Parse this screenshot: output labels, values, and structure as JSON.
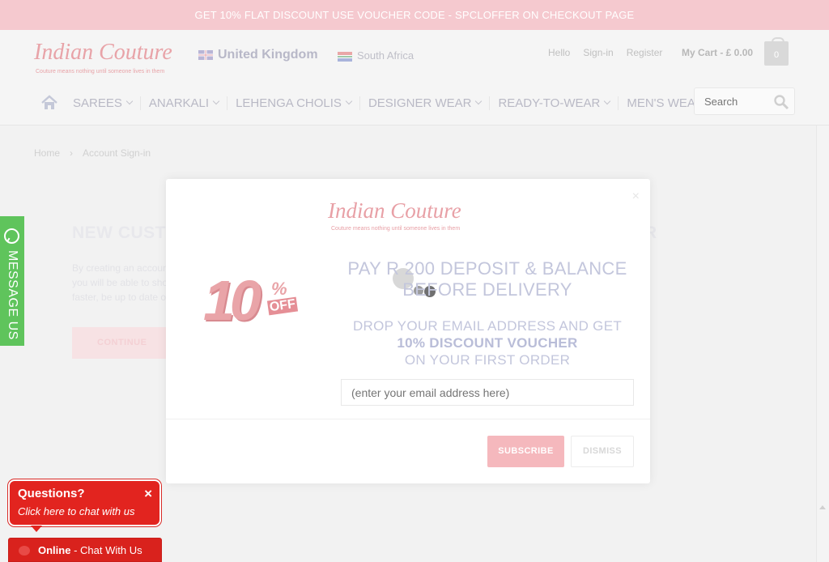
{
  "promo": {
    "text": "GET 10% FLAT DISCOUNT USE VOUCHER CODE - SPCLOFFER ON CHECKOUT PAGE"
  },
  "header": {
    "logo_text": "Indian Couture",
    "logo_tagline": "Couture means nothing until someone lives in them",
    "country_primary": "United Kingdom",
    "country_secondary": "South Africa",
    "hello": "Hello",
    "signin": "Sign-in",
    "register": "Register",
    "cart_label": "My Cart - £ 0.00",
    "cart_count": "0"
  },
  "nav": {
    "items": [
      {
        "label": "SAREES"
      },
      {
        "label": "ANARKALI"
      },
      {
        "label": "LEHENGA CHOLIS"
      },
      {
        "label": "DESIGNER WEAR"
      },
      {
        "label": "READY-TO-WEAR"
      },
      {
        "label": "MEN'S WEAR"
      }
    ],
    "search_placeholder": "Search"
  },
  "breadcrumb": {
    "home": "Home",
    "separator": "›",
    "current": "Account Sign-in"
  },
  "page": {
    "new_customer_title": "NEW CUSTOMER",
    "new_customer_text": "By creating an account you will be able to shop faster, be up to date on an order's status, and keep track of the orders you have previously made.",
    "continue_label": "CONTINUE",
    "returning_title": "RETURNING CUSTOMER"
  },
  "message_tab": {
    "label": "MESSAGE US"
  },
  "modal": {
    "close": "×",
    "logo_text": "Indian Couture",
    "logo_tagline": "Couture means nothing until someone lives in them",
    "badge_number": "10",
    "badge_percent": "%",
    "badge_off": "OFF",
    "heading": "PAY R 200 DEPOSIT & BALANCE BEFORE DELIVERY",
    "sub_line1": "DROP YOUR EMAIL ADDRESS AND GET",
    "sub_line2": "10% DISCOUNT VOUCHER",
    "sub_line3": "ON YOUR FIRST ORDER",
    "email_placeholder": "(enter your email address here)",
    "subscribe_label": "SUBSCRIBE",
    "dismiss_label": "DISMISS"
  },
  "chat": {
    "question": "Questions?",
    "prompt": "Click here to chat with us",
    "close": "×",
    "status": "Online",
    "bar_text": " - Chat With Us"
  },
  "colors": {
    "promo_bg": "#f5c9cf",
    "accent_pink": "#f5b8bd",
    "chat_red": "#e2241f",
    "message_green": "#5fc45c"
  }
}
